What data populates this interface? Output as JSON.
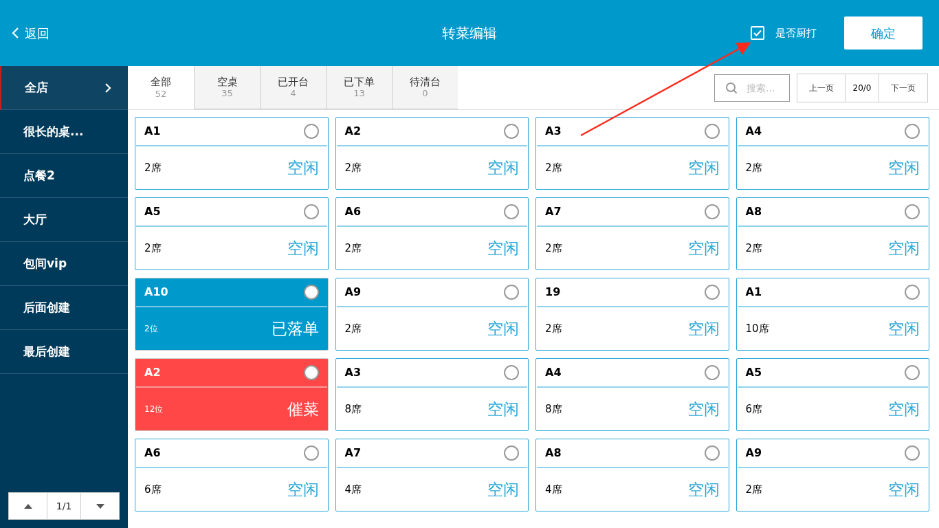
{
  "header": {
    "back": "返回",
    "title": "转菜编辑",
    "kitchen_print": {
      "label": "是否厨打",
      "checked": true
    },
    "confirm": "确定"
  },
  "sidebar": {
    "items": [
      {
        "label": "全店",
        "selected": true
      },
      {
        "label": "很长的桌...",
        "selected": false
      },
      {
        "label": "点餐2",
        "selected": false
      },
      {
        "label": "大厅",
        "selected": false
      },
      {
        "label": "包间vip",
        "selected": false
      },
      {
        "label": "后面创建",
        "selected": false
      },
      {
        "label": "最后创建",
        "selected": false
      }
    ],
    "pager": {
      "page": "1/1"
    }
  },
  "tabs": [
    {
      "label": "全部",
      "count": "52",
      "selected": true
    },
    {
      "label": "空桌",
      "count": "35",
      "selected": false
    },
    {
      "label": "已开台",
      "count": "4",
      "selected": false
    },
    {
      "label": "已下单",
      "count": "13",
      "selected": false
    },
    {
      "label": "待清台",
      "count": "0",
      "selected": false
    }
  ],
  "search": {
    "placeholder": "搜索..."
  },
  "pagination": {
    "prev": "上一页",
    "page": "20/0",
    "next": "下一页"
  },
  "tables": [
    {
      "name": "A1",
      "seats": "2席",
      "status": "空闲",
      "kind": "idle",
      "selected": false
    },
    {
      "name": "A2",
      "seats": "2席",
      "status": "空闲",
      "kind": "idle",
      "selected": false
    },
    {
      "name": "A3",
      "seats": "2席",
      "status": "空闲",
      "kind": "idle",
      "selected": false
    },
    {
      "name": "A4",
      "seats": "2席",
      "status": "空闲",
      "kind": "idle",
      "selected": false
    },
    {
      "name": "A5",
      "seats": "2席",
      "status": "空闲",
      "kind": "idle",
      "selected": false
    },
    {
      "name": "A6",
      "seats": "2席",
      "status": "空闲",
      "kind": "idle",
      "selected": false
    },
    {
      "name": "A7",
      "seats": "2席",
      "status": "空闲",
      "kind": "idle",
      "selected": false
    },
    {
      "name": "A8",
      "seats": "2席",
      "status": "空闲",
      "kind": "idle",
      "selected": false
    },
    {
      "name": "A10",
      "seats": "2位",
      "status": "已落单",
      "kind": "ordered",
      "selected": false
    },
    {
      "name": "A9",
      "seats": "2席",
      "status": "空闲",
      "kind": "idle",
      "selected": false
    },
    {
      "name": "19",
      "seats": "2席",
      "status": "空闲",
      "kind": "idle",
      "selected": false
    },
    {
      "name": "A1",
      "seats": "10席",
      "status": "空闲",
      "kind": "idle",
      "selected": false
    },
    {
      "name": "A2",
      "seats": "12位",
      "status": "催菜",
      "kind": "urge",
      "selected": false
    },
    {
      "name": "A3",
      "seats": "8席",
      "status": "空闲",
      "kind": "idle",
      "selected": false
    },
    {
      "name": "A4",
      "seats": "8席",
      "status": "空闲",
      "kind": "idle",
      "selected": false
    },
    {
      "name": "A5",
      "seats": "6席",
      "status": "空闲",
      "kind": "idle",
      "selected": false
    },
    {
      "name": "A6",
      "seats": "6席",
      "status": "空闲",
      "kind": "idle",
      "selected": false
    },
    {
      "name": "A7",
      "seats": "4席",
      "status": "空闲",
      "kind": "idle",
      "selected": false
    },
    {
      "name": "A8",
      "seats": "4席",
      "status": "空闲",
      "kind": "idle",
      "selected": false
    },
    {
      "name": "A9",
      "seats": "2席",
      "status": "空闲",
      "kind": "idle",
      "selected": false
    }
  ]
}
